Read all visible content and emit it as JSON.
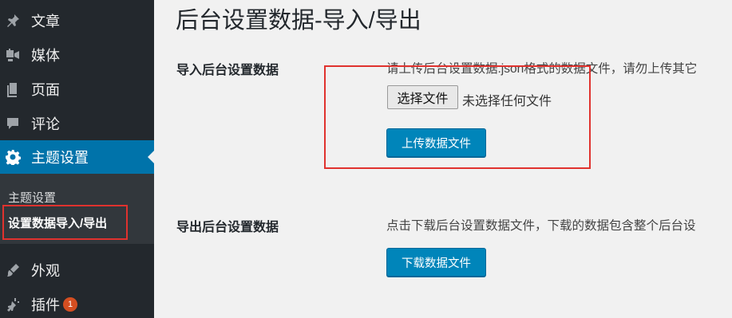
{
  "sidebar": {
    "items": [
      {
        "label": "文章",
        "icon": "pin-icon"
      },
      {
        "label": "媒体",
        "icon": "media-icon"
      },
      {
        "label": "页面",
        "icon": "page-icon"
      },
      {
        "label": "评论",
        "icon": "comment-icon"
      },
      {
        "label": "主题设置",
        "icon": "gear-icon"
      },
      {
        "label": "外观",
        "icon": "brush-icon"
      },
      {
        "label": "插件",
        "icon": "plugin-icon",
        "badge": "1"
      }
    ],
    "submenu": [
      {
        "label": "主题设置"
      },
      {
        "label": "设置数据导入/导出"
      }
    ]
  },
  "main": {
    "title": "后台设置数据-导入/导出",
    "import": {
      "label": "导入后台设置数据",
      "description": "请上传后台设置数据.json格式的数据文件，请勿上传其它",
      "choose_file": "选择文件",
      "file_status": "未选择任何文件",
      "upload_button": "上传数据文件"
    },
    "export": {
      "label": "导出后台设置数据",
      "description": "点击下载后台设置数据文件，下载的数据包含整个后台设",
      "download_button": "下载数据文件"
    }
  },
  "colors": {
    "sidebar_bg": "#23282d",
    "submenu_bg": "#32373c",
    "active": "#0073aa",
    "button": "#0085ba",
    "highlight": "#e0322e",
    "badge": "#d54e21"
  }
}
